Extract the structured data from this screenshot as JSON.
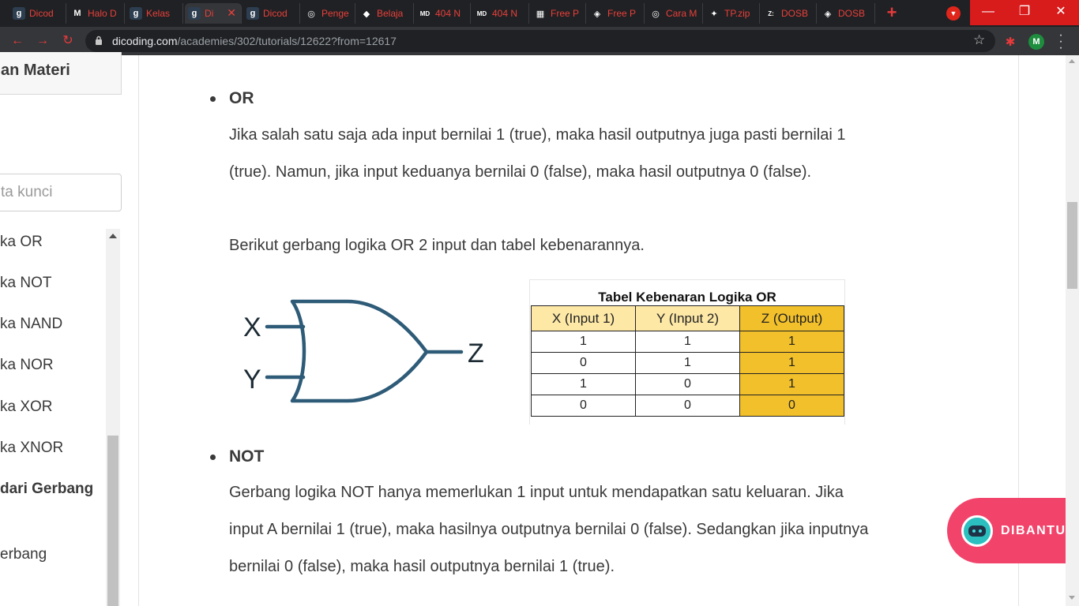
{
  "browser": {
    "tabs": [
      {
        "icon": "g",
        "icon_bg": "#2d3e50",
        "title": "Dicod"
      },
      {
        "icon": "M",
        "icon_bg": "#202124",
        "title": "Halo D"
      },
      {
        "icon": "g",
        "icon_bg": "#2d3e50",
        "title": "Kelas"
      },
      {
        "icon": "g",
        "icon_bg": "#2d3e50",
        "title": "Di",
        "active": true
      },
      {
        "icon": "g",
        "icon_bg": "#2d3e50",
        "title": "Dicod"
      },
      {
        "icon": "◎",
        "icon_bg": "#202124",
        "title": "Penge"
      },
      {
        "icon": "◆",
        "icon_bg": "#202124",
        "title": "Belaja"
      },
      {
        "icon": "MD",
        "icon_bg": "#202124",
        "title": "404 N"
      },
      {
        "icon": "MD",
        "icon_bg": "#202124",
        "title": "404 N"
      },
      {
        "icon": "▦",
        "icon_bg": "#202124",
        "title": "Free P"
      },
      {
        "icon": "◈",
        "icon_bg": "#202124",
        "title": "Free P"
      },
      {
        "icon": "◎",
        "icon_bg": "#202124",
        "title": "Cara M"
      },
      {
        "icon": "✦",
        "icon_bg": "#202124",
        "title": "TP.zip"
      },
      {
        "icon": "Z:",
        "icon_bg": "#202124",
        "title": "DOSB"
      },
      {
        "icon": "◈",
        "icon_bg": "#202124",
        "title": "DOSB"
      }
    ],
    "new_tab": "+",
    "window_controls": {
      "minimize": "—",
      "maximize": "❐",
      "close": "✕"
    },
    "nav": {
      "back": "←",
      "forward": "→",
      "reload": "↻"
    },
    "url_host": "dicoding.com",
    "url_path": "/academies/302/tutorials/12622?from=12617",
    "bookmark_icon": "☆",
    "profile_letter": "M"
  },
  "sidebar": {
    "header": "an Materi",
    "search_placeholder": "ta kunci",
    "items": [
      {
        "label": "ka OR",
        "bold": false
      },
      {
        "label": "ka NOT",
        "bold": false
      },
      {
        "label": "ka NAND",
        "bold": false
      },
      {
        "label": "ka NOR",
        "bold": false
      },
      {
        "label": "ka XOR",
        "bold": false
      },
      {
        "label": "ka XNOR",
        "bold": false
      },
      {
        "label": "dari Gerbang",
        "bold": true
      },
      {
        "label": "erbang",
        "bold": false
      }
    ]
  },
  "content": {
    "or_heading": "OR",
    "or_p1_line1": "Jika salah satu saja ada input bernilai 1 (true), maka hasil outputnya juga pasti bernilai 1",
    "or_p1_line2": "(true). Namun, jika input keduanya bernilai 0 (false), maka hasil outputnya 0 (false).",
    "or_p2": "Berikut gerbang logika OR 2 input dan tabel kebenarannya.",
    "gate": {
      "input_x": "X",
      "input_y": "Y",
      "output_z": "Z",
      "stroke_color": "#2e5b77"
    },
    "truth_table": {
      "title": "Tabel Kebenaran Logika OR",
      "headers": [
        "X (Input 1)",
        "Y (Input 2)",
        "Z (Output)"
      ],
      "rows": [
        [
          "1",
          "1",
          "1"
        ],
        [
          "0",
          "1",
          "1"
        ],
        [
          "1",
          "0",
          "1"
        ],
        [
          "0",
          "0",
          "0"
        ]
      ],
      "header_color": "#fde8a6",
      "output_color": "#f2c02a"
    },
    "not_heading": "NOT",
    "not_line1": "Gerbang logika NOT hanya memerlukan 1 input untuk mendapatkan satu keluaran. Jika",
    "not_line2": "input A bernilai 1 (true), maka hasilnya outputnya bernilai 0 (false). Sedangkan jika inputnya",
    "not_line3": "bernilai 0 (false), maka hasil outputnya bernilai 1 (true)."
  },
  "help_button": {
    "label": "DIBANTU",
    "color": "#f2436b"
  }
}
